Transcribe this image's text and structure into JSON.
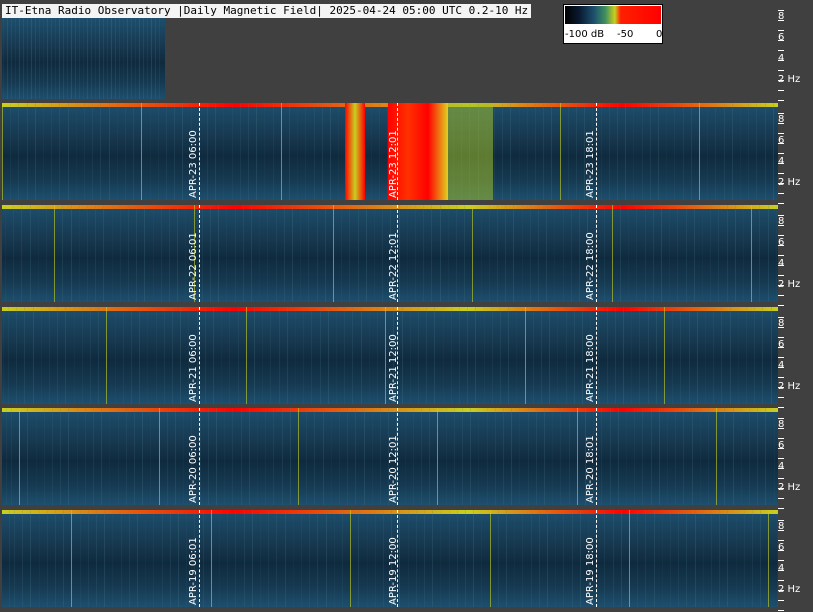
{
  "title": "IT-Etna Radio Observatory |Daily Magnetic Field| 2025-04-24 05:00 UTC 0.2-10 Hz",
  "colorbar": {
    "min_label": "-100 dB",
    "mid_label": "-50",
    "max_label": "0"
  },
  "axis_labels": [
    "8",
    "6",
    "4",
    "2 Hz"
  ],
  "colors": {
    "background": "#404040",
    "spectrogram_low": "#0d2436",
    "spectrogram_mid": "#1d4f6e",
    "activity": "#c8d020",
    "intense": "#ff0000",
    "markers": "#ffffff"
  },
  "panels": [
    {
      "date": "APR-23",
      "markers": [
        "APR-23 06:00",
        "APR-23 12:01",
        "APR-23 18:01"
      ]
    },
    {
      "date": "APR-22",
      "markers": [
        "APR-22 06:01",
        "APR-22 12:01",
        "APR-22 18:00"
      ]
    },
    {
      "date": "APR-21",
      "markers": [
        "APR-21 06:00",
        "APR-21 12:00",
        "APR-21 18:00"
      ]
    },
    {
      "date": "APR-20",
      "markers": [
        "APR-20 06:00",
        "APR-20 12:01",
        "APR-20 18:01"
      ]
    },
    {
      "date": "APR-19",
      "markers": [
        "APR-19 06:01",
        "APR-19 12:00",
        "APR-19 18:00"
      ]
    }
  ]
}
